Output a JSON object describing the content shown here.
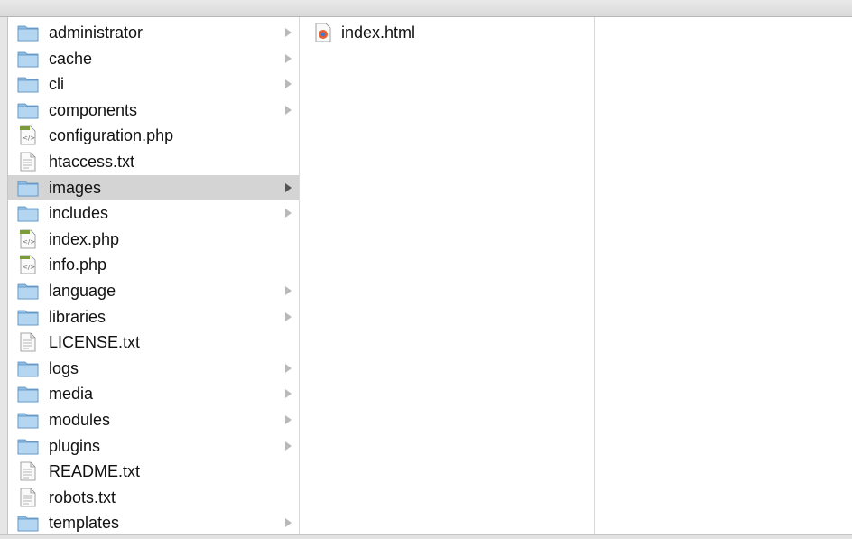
{
  "columns": [
    {
      "items": [
        {
          "label": "administrator",
          "type": "folder",
          "has_children": true,
          "selected": false
        },
        {
          "label": "cache",
          "type": "folder",
          "has_children": true,
          "selected": false
        },
        {
          "label": "cli",
          "type": "folder",
          "has_children": true,
          "selected": false
        },
        {
          "label": "components",
          "type": "folder",
          "has_children": true,
          "selected": false
        },
        {
          "label": "configuration.php",
          "type": "php",
          "has_children": false,
          "selected": false
        },
        {
          "label": "htaccess.txt",
          "type": "text",
          "has_children": false,
          "selected": false
        },
        {
          "label": "images",
          "type": "folder",
          "has_children": true,
          "selected": true
        },
        {
          "label": "includes",
          "type": "folder",
          "has_children": true,
          "selected": false
        },
        {
          "label": "index.php",
          "type": "php",
          "has_children": false,
          "selected": false
        },
        {
          "label": "info.php",
          "type": "php",
          "has_children": false,
          "selected": false
        },
        {
          "label": "language",
          "type": "folder",
          "has_children": true,
          "selected": false
        },
        {
          "label": "libraries",
          "type": "folder",
          "has_children": true,
          "selected": false
        },
        {
          "label": "LICENSE.txt",
          "type": "text",
          "has_children": false,
          "selected": false
        },
        {
          "label": "logs",
          "type": "folder",
          "has_children": true,
          "selected": false
        },
        {
          "label": "media",
          "type": "folder",
          "has_children": true,
          "selected": false
        },
        {
          "label": "modules",
          "type": "folder",
          "has_children": true,
          "selected": false
        },
        {
          "label": "plugins",
          "type": "folder",
          "has_children": true,
          "selected": false
        },
        {
          "label": "README.txt",
          "type": "text",
          "has_children": false,
          "selected": false
        },
        {
          "label": "robots.txt",
          "type": "text",
          "has_children": false,
          "selected": false
        },
        {
          "label": "templates",
          "type": "folder",
          "has_children": true,
          "selected": false
        }
      ]
    },
    {
      "items": [
        {
          "label": "index.html",
          "type": "html",
          "has_children": false,
          "selected": false
        }
      ]
    },
    {
      "items": []
    }
  ],
  "icons": {
    "folder": "folder-icon",
    "php": "php-file-icon",
    "text": "text-file-icon",
    "html": "html-file-icon"
  },
  "colors": {
    "selection": "#d4d4d4",
    "folder_blue": "#a9cdea",
    "chevron": "#b9b9b9",
    "chevron_selected": "#555555"
  }
}
